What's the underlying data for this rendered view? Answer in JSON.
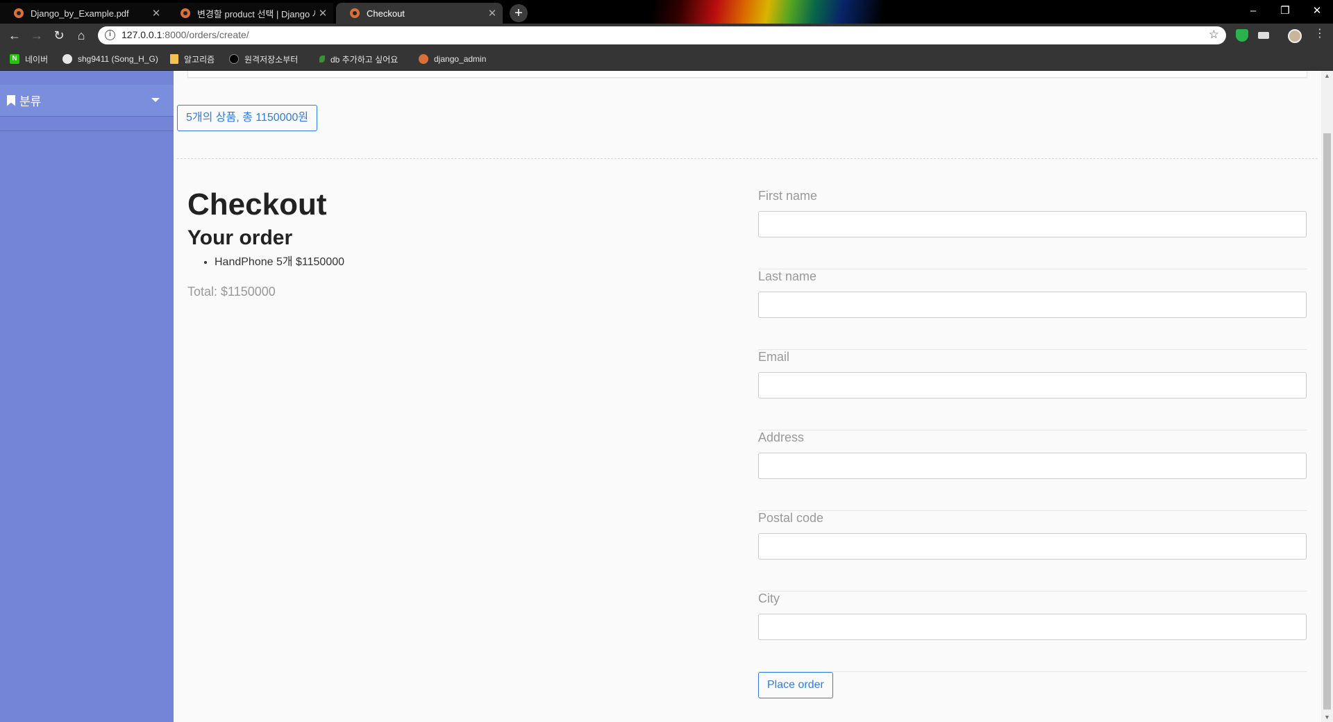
{
  "browser": {
    "tabs": [
      {
        "title": "Django_by_Example.pdf",
        "active": false
      },
      {
        "title": "변경할 product 선택 | Django 사이트",
        "active": false
      },
      {
        "title": "Checkout",
        "active": true
      }
    ],
    "url_host": "127.0.0.1",
    "url_path": ":8000/orders/create/",
    "bookmarks": [
      {
        "label": "네이버",
        "icon": "naver-icon"
      },
      {
        "label": "shg9411 (Song_H_G)",
        "icon": "github-icon"
      },
      {
        "label": "알고리즘",
        "icon": "folder-icon"
      },
      {
        "label": "원격저장소부터",
        "icon": "dot-icon"
      },
      {
        "label": "db 추가하고 싶어요",
        "icon": "leaf-icon"
      },
      {
        "label": "django_admin",
        "icon": "django-icon"
      }
    ]
  },
  "sidebar": {
    "category_label": "분류"
  },
  "cart": {
    "summary": "5개의 상품, 총 1150000원"
  },
  "checkout": {
    "title": "Checkout",
    "order_heading": "Your order",
    "items": [
      "HandPhone 5개 $1150000"
    ],
    "total": "Total: $1150000"
  },
  "form": {
    "fields": [
      {
        "label": "First name",
        "value": ""
      },
      {
        "label": "Last name",
        "value": ""
      },
      {
        "label": "Email",
        "value": ""
      },
      {
        "label": "Address",
        "value": ""
      },
      {
        "label": "Postal code",
        "value": ""
      },
      {
        "label": "City",
        "value": ""
      }
    ],
    "submit_label": "Place order"
  },
  "colors": {
    "sidebar": "#7485d8",
    "accent": "#2f7de1",
    "tab_active": "#353535"
  }
}
